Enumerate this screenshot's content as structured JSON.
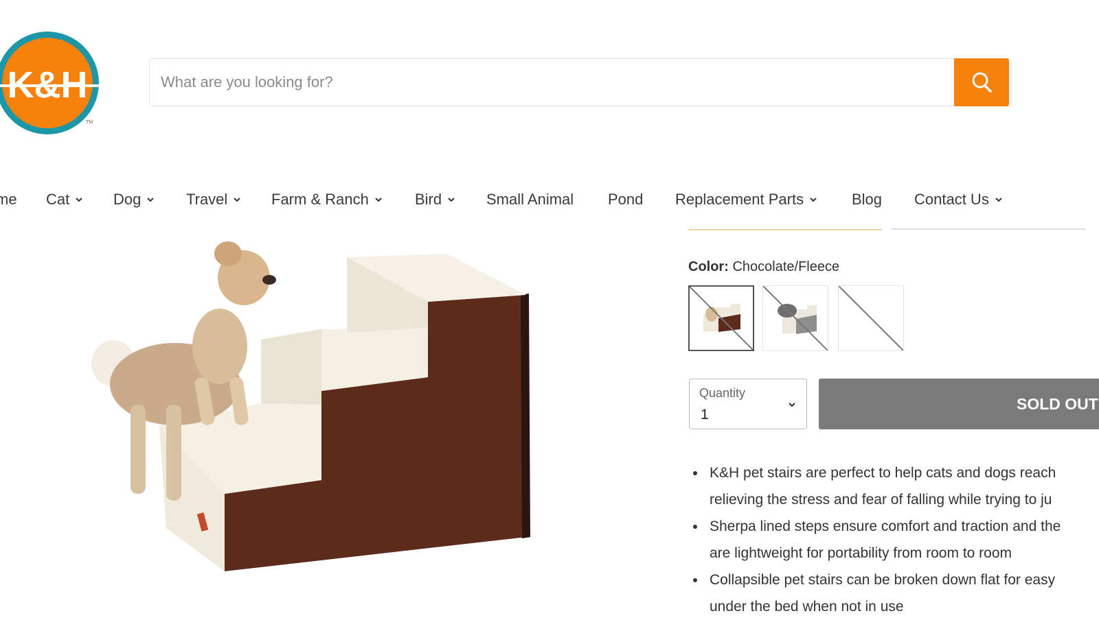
{
  "brand": {
    "logo_text": "K&H",
    "colors": {
      "accent": "#f7810d",
      "ring": "#1b97a8",
      "orange": "#f7810d"
    }
  },
  "search": {
    "placeholder": "What are you looking for?",
    "value": "",
    "icon": "search-icon"
  },
  "nav": {
    "items": [
      {
        "label": "me",
        "has_dropdown": false
      },
      {
        "label": "Cat",
        "has_dropdown": true
      },
      {
        "label": "Dog",
        "has_dropdown": true
      },
      {
        "label": "Travel",
        "has_dropdown": true
      },
      {
        "label": "Farm & Ranch",
        "has_dropdown": true
      },
      {
        "label": "Bird",
        "has_dropdown": true
      },
      {
        "label": "Small Animal",
        "has_dropdown": false
      },
      {
        "label": "Pond",
        "has_dropdown": false
      },
      {
        "label": "Replacement Parts",
        "has_dropdown": true
      },
      {
        "label": "Blog",
        "has_dropdown": false
      },
      {
        "label": "Contact Us",
        "has_dropdown": true
      }
    ]
  },
  "product": {
    "color_label": "Color:",
    "color_value": "Chocolate/Fleece",
    "swatches": [
      {
        "name": "Chocolate/Fleece",
        "selected": true,
        "unavailable": true
      },
      {
        "name": "Gray/Fleece",
        "selected": false,
        "unavailable": true
      },
      {
        "name": "Unavailable option",
        "selected": false,
        "unavailable": true
      }
    ],
    "quantity_label": "Quantity",
    "quantity_value": "1",
    "sold_out_label": "SOLD OUT",
    "bullets": [
      "K&H pet stairs are perfect to help cats and dogs reach",
      "relieving the stress and fear of falling while trying to ju",
      "Sherpa lined steps ensure comfort and traction and the",
      "are lightweight for portability from room to room",
      "Collapsible pet stairs can be broken down flat for easy",
      "under the bed when not in use"
    ]
  }
}
